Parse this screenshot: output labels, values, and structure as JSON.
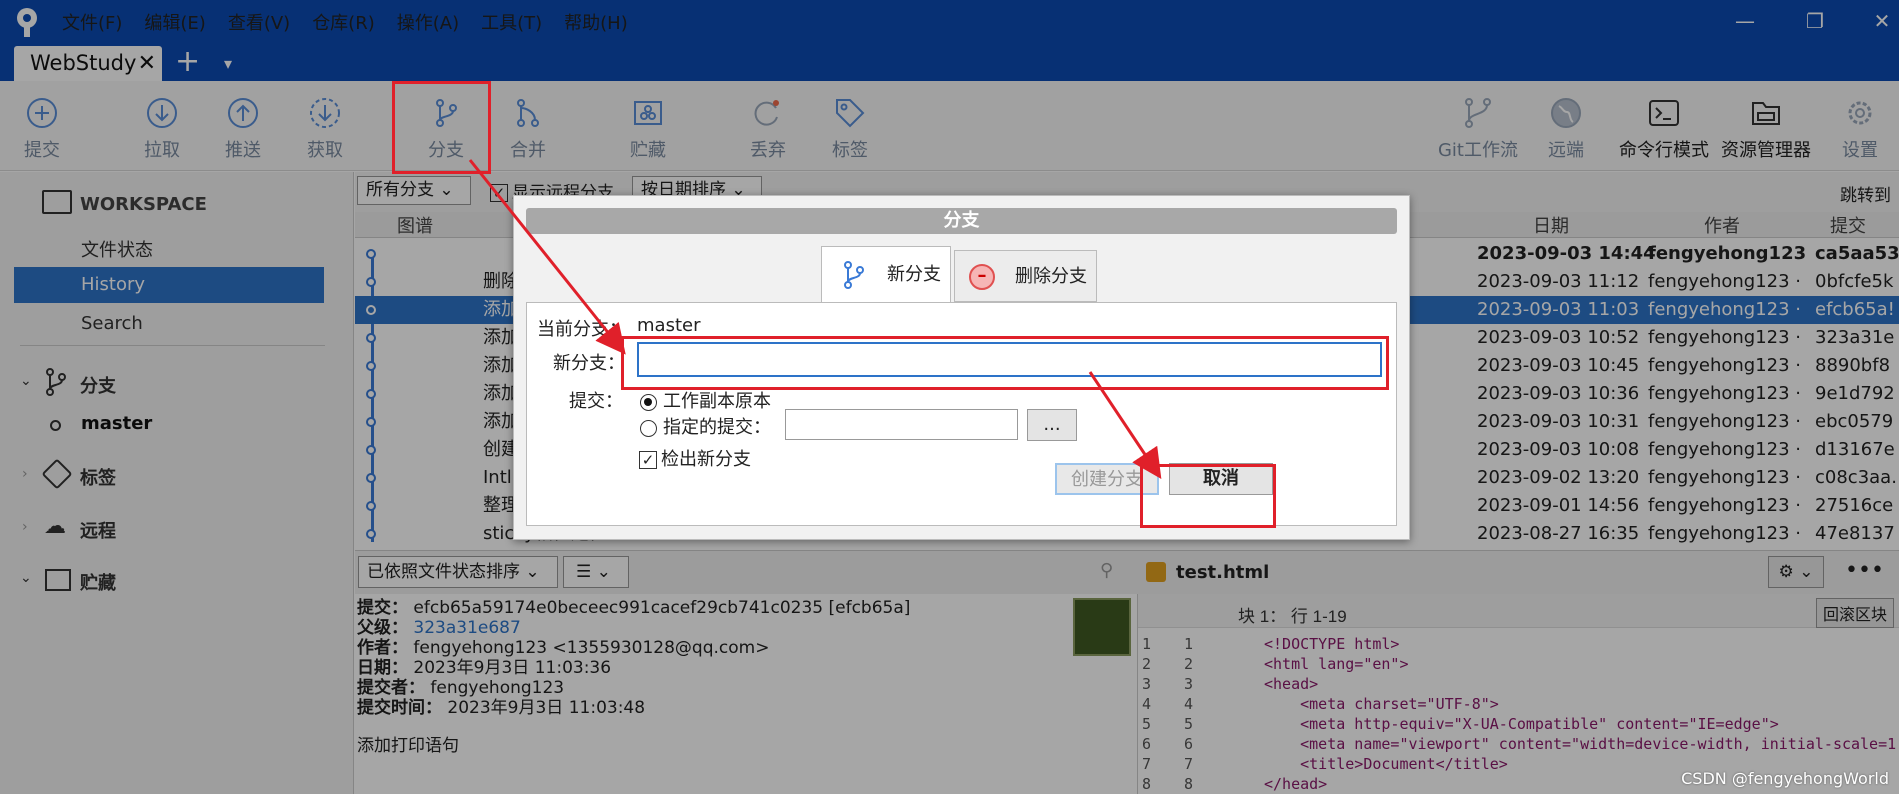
{
  "menu": [
    "文件(F)",
    "编辑(E)",
    "查看(V)",
    "仓库(R)",
    "操作(A)",
    "工具(T)",
    "帮助(H)"
  ],
  "repo_tab": "WebStudy",
  "toolbar": {
    "commit": "提交",
    "pull": "拉取",
    "push": "推送",
    "fetch": "获取",
    "branch": "分支",
    "merge": "合并",
    "stash": "贮藏",
    "discard": "丢弃",
    "tag": "标签",
    "gitflow": "Git工作流",
    "remote": "远端",
    "terminal": "命令行模式",
    "explorer": "资源管理器",
    "settings": "设置"
  },
  "sidebar": {
    "workspace": "WORKSPACE",
    "file_status": "文件状态",
    "history": "History",
    "search": "Search",
    "branches": "分支",
    "branch_master": "master",
    "tags": "标签",
    "remotes": "远程",
    "stashes": "贮藏"
  },
  "filterbar": {
    "all_branches": "所有分支",
    "show_remote": "显示远程分支",
    "sort": "按日期排序",
    "jump_to": "跳转到"
  },
  "grid_head": {
    "graph": "图谱",
    "date": "日期",
    "author": "作者",
    "commit": "提交"
  },
  "commits": [
    {
      "msg": "",
      "date": "2023-09-03 14:44",
      "author": "fengyehong123",
      "hash": "ca5aa53",
      "bold": true
    },
    {
      "msg": "删除",
      "date": "2023-09-03 11:12",
      "author": "fengyehong123 ·",
      "hash": "0bfcfe5k"
    },
    {
      "msg": "添加",
      "date": "2023-09-03 11:03",
      "author": "fengyehong123 ·",
      "hash": "efcb65a!",
      "sel": true
    },
    {
      "msg": "添加",
      "date": "2023-09-03 10:52",
      "author": "fengyehong123 ·",
      "hash": "323a31e"
    },
    {
      "msg": "添加",
      "date": "2023-09-03 10:45",
      "author": "fengyehong123 ·",
      "hash": "8890bf8"
    },
    {
      "msg": "添加",
      "date": "2023-09-03 10:36",
      "author": "fengyehong123 ·",
      "hash": "9e1d792"
    },
    {
      "msg": "添加",
      "date": "2023-09-03 10:31",
      "author": "fengyehong123 ·",
      "hash": "ebc0579"
    },
    {
      "msg": "创建",
      "date": "2023-09-03 10:08",
      "author": "fengyehong123 ·",
      "hash": "d13167e"
    },
    {
      "msg": "Intl",
      "date": "2023-09-02 13:20",
      "author": "fengyehong123 ·",
      "hash": "c08c3aa."
    },
    {
      "msg": "整理",
      "date": "2023-09-01 14:56",
      "author": "fengyehong123 ·",
      "hash": "27516ce"
    },
    {
      "msg": "sticky相位定位",
      "date": "2023-08-27 16:35",
      "author": "fengyehong123 ·",
      "hash": "47e8137"
    }
  ],
  "bottombar": {
    "sort": "已依照文件状态排序",
    "file": "test.html"
  },
  "details": {
    "commit_k": "提交：",
    "commit_v": "efcb65a59174e0beceec991cacef29cb741c0235 [efcb65a]",
    "parent_k": "父级：",
    "parent_v": "323a31e687",
    "author_k": "作者：",
    "author_v": "fengyehong123 <1355930128@qq.com>",
    "date_k": "日期：",
    "date_v": "2023年9月3日 11:03:36",
    "committer_k": "提交者：",
    "committer_v": "fengyehong123",
    "ctime_k": "提交时间：",
    "ctime_v": "2023年9月3日 11:03:48",
    "message": "添加打印语句"
  },
  "code": {
    "hunk": "块 1：  行 1-19",
    "revert": "回滚区块",
    "lines": [
      "<!DOCTYPE html>",
      "<html lang=\"en\">",
      "<head>",
      "    <meta charset=\"UTF-8\">",
      "    <meta http-equiv=\"X-UA-Compatible\" content=\"IE=edge\">",
      "    <meta name=\"viewport\" content=\"width=device-width, initial-scale=1",
      "    <title>Document</title>",
      "</head>"
    ]
  },
  "dialog": {
    "title": "分支",
    "tab_new": "新分支",
    "tab_delete": "删除分支",
    "current_label": "当前分支：",
    "current_value": "master",
    "new_label": "新分支：",
    "new_value": "",
    "commit_label": "提交：",
    "opt_working": "工作副本原本",
    "opt_specified": "指定的提交：",
    "browse": "...",
    "checkout": "检出新分支",
    "create": "创建分支",
    "cancel": "取消"
  },
  "watermark": "CSDN @fengyehongWorld"
}
